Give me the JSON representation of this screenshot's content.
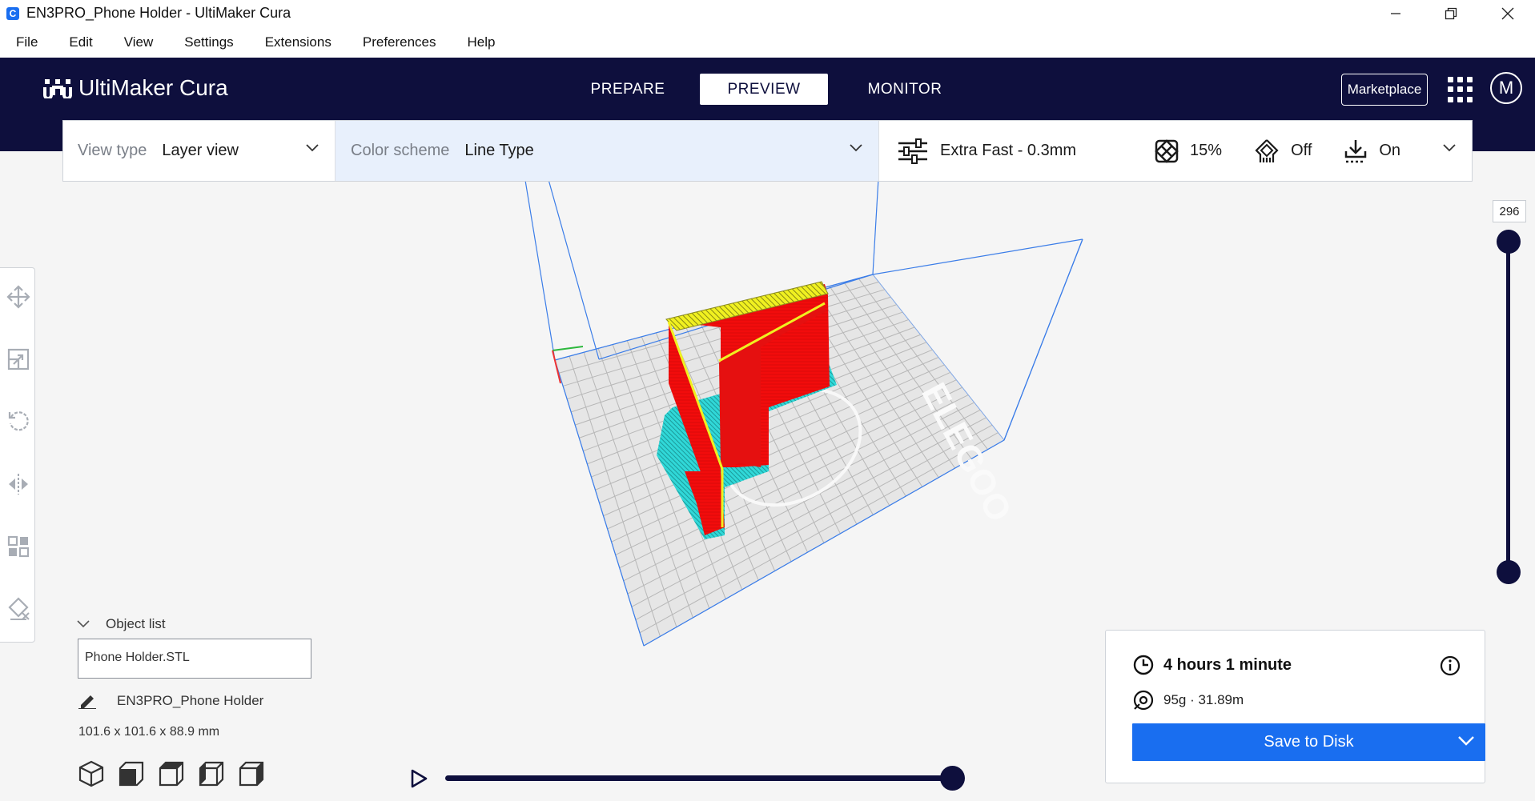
{
  "window": {
    "title": "EN3PRO_Phone Holder - UltiMaker Cura",
    "app_icon": "C"
  },
  "menu": [
    "File",
    "Edit",
    "View",
    "Settings",
    "Extensions",
    "Preferences",
    "Help"
  ],
  "header": {
    "logo": "UltiMaker Cura",
    "tabs": [
      "PREPARE",
      "PREVIEW",
      "MONITOR"
    ],
    "active_tab": "PREVIEW",
    "marketplace": "Marketplace",
    "avatar_initial": "M"
  },
  "toolbar": {
    "view_type_label": "View type",
    "view_type_value": "Layer view",
    "color_scheme_label": "Color scheme",
    "color_scheme_value": "Line Type",
    "profile": "Extra Fast - 0.3mm",
    "infill": "15%",
    "support": "Off",
    "adhesion": "On"
  },
  "viewport": {
    "bed_brand": "ELEGOO",
    "model_colors": {
      "wall": "#f20c0c",
      "top_skin": "#f0f020",
      "support": "#30d8d8",
      "build_volume": "#3b7de8"
    }
  },
  "object_list": {
    "toggle_label": "Object list",
    "item": "Phone Holder.STL",
    "job_name": "EN3PRO_Phone Holder",
    "dimensions": "101.6 x 101.6 x 88.9 mm"
  },
  "layer_slider": {
    "value": "296"
  },
  "print_info": {
    "time": "4 hours 1 minute",
    "material": "95g · 31.89m",
    "save_label": "Save to Disk"
  },
  "colors": {
    "header": "#0e0f3d",
    "accent": "#196ef0"
  }
}
